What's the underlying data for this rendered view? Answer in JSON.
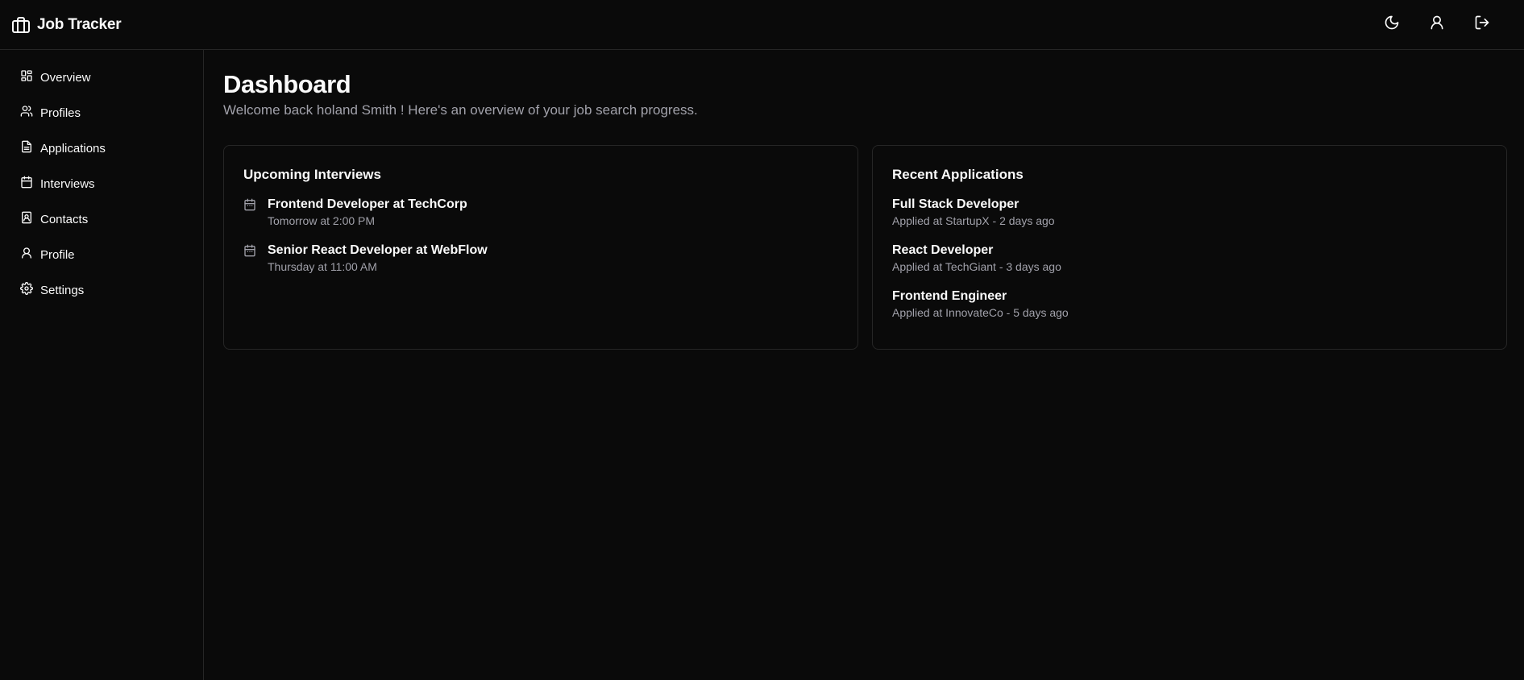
{
  "header": {
    "title": "Job Tracker",
    "brand_icon": "briefcase-icon",
    "actions": [
      {
        "name": "theme-toggle",
        "icon": "moon-icon"
      },
      {
        "name": "user-profile",
        "icon": "user-icon"
      },
      {
        "name": "logout",
        "icon": "logout-icon"
      }
    ]
  },
  "sidebar": {
    "items": [
      {
        "label": "Overview",
        "icon": "grid-icon"
      },
      {
        "label": "Profiles",
        "icon": "users-icon"
      },
      {
        "label": "Applications",
        "icon": "file-icon"
      },
      {
        "label": "Interviews",
        "icon": "calendar-icon"
      },
      {
        "label": "Contacts",
        "icon": "contact-book-icon"
      },
      {
        "label": "Profile",
        "icon": "user-icon"
      },
      {
        "label": "Settings",
        "icon": "gear-icon"
      }
    ]
  },
  "main": {
    "title": "Dashboard",
    "subtitle": "Welcome back holand Smith ! Here's an overview of your job search progress."
  },
  "interviews": {
    "title": "Upcoming Interviews",
    "items": [
      {
        "title": "Frontend Developer at TechCorp",
        "time": "Tomorrow at 2:00 PM"
      },
      {
        "title": "Senior React Developer at WebFlow",
        "time": "Thursday at 11:00 AM"
      }
    ]
  },
  "applications": {
    "title": "Recent Applications",
    "items": [
      {
        "title": "Full Stack Developer",
        "detail": "Applied at StartupX - 2 days ago"
      },
      {
        "title": "React Developer",
        "detail": "Applied at TechGiant - 3 days ago"
      },
      {
        "title": "Frontend Engineer",
        "detail": "Applied at InnovateCo - 5 days ago"
      }
    ]
  },
  "colors": {
    "background": "#0a0a0a",
    "border": "#262626",
    "muted_text": "#a1a1aa",
    "text": "#fafafa"
  }
}
